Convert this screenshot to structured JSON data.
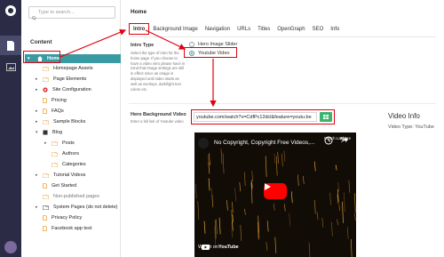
{
  "search": {
    "placeholder": "Type to search..."
  },
  "tree": {
    "heading": "Content",
    "items": [
      {
        "label": "Home",
        "icon": "home-icon",
        "color": "#ffffff"
      },
      {
        "label": "Homepage Assets",
        "icon": "folder-icon",
        "color": "#e8a640"
      },
      {
        "label": "Page Elements",
        "icon": "folder-icon",
        "color": "#e8a640"
      },
      {
        "label": "Site Configuration",
        "icon": "settings-icon",
        "color": "#e3342f"
      },
      {
        "label": "Pricing",
        "icon": "page-icon",
        "color": "#e8a640"
      },
      {
        "label": "FAQs",
        "icon": "page-icon",
        "color": "#e8a640"
      },
      {
        "label": "Sample Blocks",
        "icon": "folder-icon",
        "color": "#e8a640"
      },
      {
        "label": "Blog",
        "icon": "book-icon",
        "color": "#333333"
      },
      {
        "label": "Posts",
        "icon": "folder-icon",
        "color": "#e8a640"
      },
      {
        "label": "Authors",
        "icon": "folder-icon",
        "color": "#e8a640"
      },
      {
        "label": "Categories",
        "icon": "folder-icon",
        "color": "#e8a640"
      },
      {
        "label": "Tutorial Videos",
        "icon": "folder-icon",
        "color": "#e8a640"
      },
      {
        "label": "Get Started",
        "icon": "page-icon",
        "color": "#e8a640"
      },
      {
        "label": "Non-published pages",
        "icon": "folder-icon",
        "color": "#e8a640"
      },
      {
        "label": "System Pages (do not delete)",
        "icon": "folder-icon",
        "color": "#333333"
      },
      {
        "label": "Privacy Policy",
        "icon": "page-icon",
        "color": "#e8a640"
      },
      {
        "label": "Facebook app test",
        "icon": "page-icon",
        "color": "#e8a640"
      }
    ]
  },
  "page": {
    "title": "Home",
    "tabs": [
      "Intro",
      "Background Image",
      "Navigation",
      "URLs",
      "Titles",
      "OpenGraph",
      "SEO",
      "Info"
    ],
    "active_tab": "Intro"
  },
  "intro": {
    "label": "Intro Type",
    "help": "Select the type of intro for the home page. If you choose to have a video intro please have in mind that Image settings are still in effect since an image is displayed until video starts as well as overlays, dark/light text colors etc.",
    "options": [
      "Hero Image Slider",
      "Youtube Video"
    ],
    "selected": "Youtube Video"
  },
  "hero_video": {
    "label": "Hero Background Video",
    "help": "Enter a full link of Youtube video",
    "url": "youtube.com/watch?v=CdfPc12dcl&feature=youtu.be"
  },
  "video_info": {
    "title": "Video Info",
    "type_text": "Video Type: YouTube"
  },
  "player": {
    "title": "No Copyright, Copyright Free Videos,...",
    "watch_later": "Watch Later",
    "share": "Share",
    "watch_on": "Watch on",
    "youtube": "YouTube"
  },
  "colors": {
    "accent": "#3a9aa2",
    "highlight": "#e3000f",
    "rail": "#2b2b45"
  }
}
